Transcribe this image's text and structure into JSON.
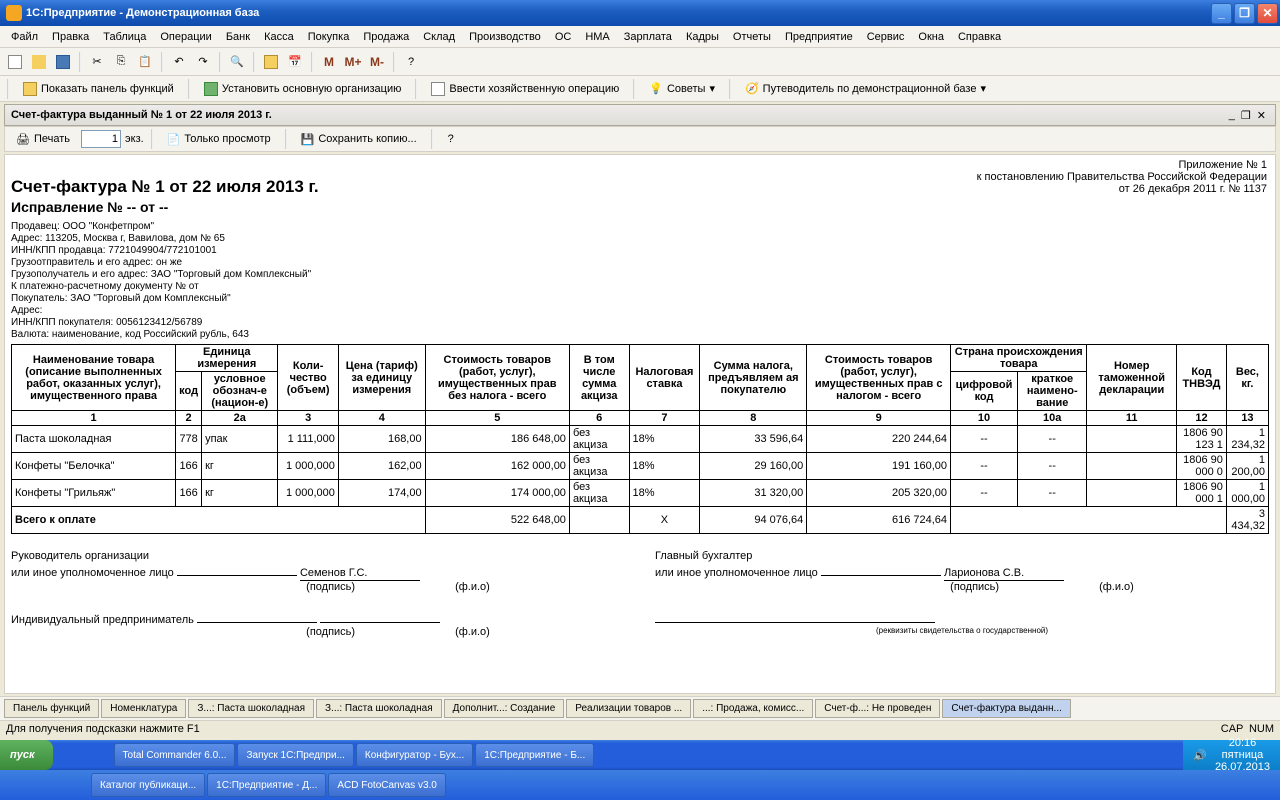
{
  "window": {
    "title": "1С:Предприятие - Демонстрационная база"
  },
  "menu": [
    "Файл",
    "Правка",
    "Таблица",
    "Операции",
    "Банк",
    "Касса",
    "Покупка",
    "Продажа",
    "Склад",
    "Производство",
    "ОС",
    "НМА",
    "Зарплата",
    "Кадры",
    "Отчеты",
    "Предприятие",
    "Сервис",
    "Окна",
    "Справка"
  ],
  "funcbar": {
    "panel": "Показать панель функций",
    "org": "Установить основную организацию",
    "op": "Ввести хозяйственную операцию",
    "tips": "Советы",
    "guide": "Путеводитель по демонстрационной базе"
  },
  "doc_tab": "Счет-фактура выданный № 1 от 22 июля 2013 г.",
  "doc_toolbar": {
    "print": "Печать",
    "copies": "1",
    "copies_label": "экз.",
    "readonly": "Только просмотр",
    "savecopy": "Сохранить копию..."
  },
  "appendix": {
    "l1": "Приложение № 1",
    "l2": "к постановлению Правительства Российской Федерации",
    "l3": "от 26 декабря 2011 г. № 1137"
  },
  "header": {
    "title": "Счет-фактура № 1 от 22 июля 2013 г.",
    "correction": "Исправление № -- от --"
  },
  "meta": {
    "seller": "Продавец: ООО \"Конфетпром\"",
    "addr": "Адрес: 113205, Москва г, Вавилова, дом № 65",
    "inn": "ИНН/КПП продавца: 7721049904/772101001",
    "shipper": "Грузоотправитель и его адрес: он же",
    "consignee": "Грузополучатель и его адрес: ЗАО \"Торговый дом Комплексный\"",
    "paydoc": "К платежно-расчетному документу №   от",
    "buyer": "Покупатель: ЗАО \"Торговый дом Комплексный\"",
    "baddr": "Адрес:",
    "binn": "ИНН/КПП покупателя: 0056123412/56789",
    "currency": "Валюта: наименование, код Российский рубль, 643"
  },
  "th": {
    "name": "Наименование товара (описание выполненных работ, оказанных услуг), имущественного права",
    "unit": "Единица измерения",
    "code": "код",
    "uname": "условное обознач-е (национ-е)",
    "qty": "Коли-чество (объем)",
    "price": "Цена (тариф) за единицу измерения",
    "cost": "Стоимость товаров (работ, услуг), имущественных прав без налога - всего",
    "excise": "В том числе сумма акциза",
    "rate": "Налоговая ставка",
    "tax": "Сумма налога, предъявляем ая покупателю",
    "total": "Стоимость товаров (работ, услуг), имущественных прав с налогом - всего",
    "country": "Страна происхождения товара",
    "ccode": "цифровой код",
    "cname": "краткое наимено-вание",
    "decl": "Номер таможенной декларации",
    "tnved": "Код ТНВЭД",
    "weight": "Вес, кг."
  },
  "cols": [
    "1",
    "2",
    "2а",
    "3",
    "4",
    "5",
    "6",
    "7",
    "8",
    "9",
    "10",
    "10а",
    "11",
    "12",
    "13"
  ],
  "rows": [
    {
      "name": "Паста шоколадная",
      "code": "778",
      "u": "упак",
      "qty": "1 111,000",
      "price": "168,00",
      "cost": "186 648,00",
      "ex": "без акциза",
      "rate": "18%",
      "tax": "33 596,64",
      "tot": "220 244,64",
      "cc": "--",
      "cn": "--",
      "decl": "",
      "tn": "1806 90 123 1",
      "w": "1 234,32"
    },
    {
      "name": "Конфеты \"Белочка\"",
      "code": "166",
      "u": "кг",
      "qty": "1 000,000",
      "price": "162,00",
      "cost": "162 000,00",
      "ex": "без акциза",
      "rate": "18%",
      "tax": "29 160,00",
      "tot": "191 160,00",
      "cc": "--",
      "cn": "--",
      "decl": "",
      "tn": "1806 90 000 0",
      "w": "1 200,00"
    },
    {
      "name": "Конфеты \"Грильяж\"",
      "code": "166",
      "u": "кг",
      "qty": "1 000,000",
      "price": "174,00",
      "cost": "174 000,00",
      "ex": "без акциза",
      "rate": "18%",
      "tax": "31 320,00",
      "tot": "205 320,00",
      "cc": "--",
      "cn": "--",
      "decl": "",
      "tn": "1806 90 000 1",
      "w": "1 000,00"
    }
  ],
  "total": {
    "label": "Всего к оплате",
    "cost": "522 648,00",
    "x": "Х",
    "tax": "94 076,64",
    "tot": "616 724,64",
    "w": "3 434,32"
  },
  "sig": {
    "head": "Руководитель организации",
    "or": "или иное уполномоченное лицо",
    "sign": "(подпись)",
    "fio": "(ф.и.о)",
    "headname": "Семенов Г.С.",
    "acc": "Главный бухгалтер",
    "accname": "Ларионова С.В.",
    "ip": "Индивидуальный предприниматель",
    "rek": "(реквизиты свидетельства о государственной)"
  },
  "tabs": [
    "Панель функций",
    "Номенклатура",
    "З...: Паста шоколадная",
    "З...: Паста шоколадная",
    "Дополнит...: Создание",
    "Реализации товаров ...",
    "...: Продажа, комисс...",
    "Счет-ф...: Не проведен",
    "Счет-фактура выданн..."
  ],
  "status": {
    "hint": "Для получения подсказки нажмите F1",
    "cap": "CAP",
    "num": "NUM"
  },
  "taskbar": {
    "start": "пуск",
    "row1": [
      "Total Commander 6.0...",
      "Запуск 1С:Предпри...",
      "Конфигуратор - Бух...",
      "1С:Предприятие - Б..."
    ],
    "row2": [
      "Каталог публикаци...",
      "1С:Предприятие - Д...",
      "ACD FotoCanvas v3.0"
    ],
    "time": "20:16",
    "day": "пятница",
    "date": "26.07.2013"
  }
}
